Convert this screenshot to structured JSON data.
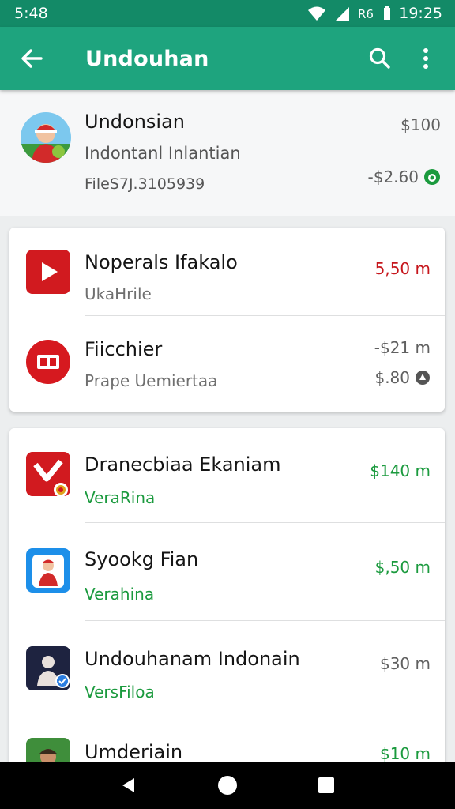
{
  "status_bar": {
    "time": "5:48",
    "right_text": "19:25"
  },
  "app_bar": {
    "title": "Undouhan"
  },
  "featured": {
    "title": "Undonsian",
    "subtitle": "Indontanl Inlantian",
    "detail": "FileS7J.3105939",
    "price": "$100",
    "price2": "-$2.60"
  },
  "card1": [
    {
      "title": "Noperals Ifakalo",
      "subtitle": "UkaHrile",
      "price": "5,50 m",
      "price_style": "red",
      "icon": "youtube-play-icon"
    },
    {
      "title": "Fiicchier",
      "subtitle": "Prape Uemiertaa",
      "price": "-$21 m",
      "price2": "$.80",
      "icon": "cinema-ticket-icon"
    }
  ],
  "card2": [
    {
      "title": "Dranecbiaa Ekaniam",
      "subtitle": "VeraRina",
      "price": "$140 m",
      "icon": "red-check-app-icon"
    },
    {
      "title": "Syookg Fian",
      "subtitle": "Verahina",
      "price": "$,50 m",
      "icon": "blue-person-app-icon"
    },
    {
      "title": "Undouhanam Indonain",
      "subtitle": "VersFiloa",
      "price": "$30 m",
      "icon": "dark-person-app-icon"
    },
    {
      "title": "Umderiain",
      "subtitle": "",
      "price": "$10 m",
      "icon": "person-avatar-icon"
    }
  ],
  "colors": {
    "status_bar": "#138a67",
    "app_bar": "#1ea47e",
    "red": "#c6161c",
    "green": "#1b9a3e"
  }
}
